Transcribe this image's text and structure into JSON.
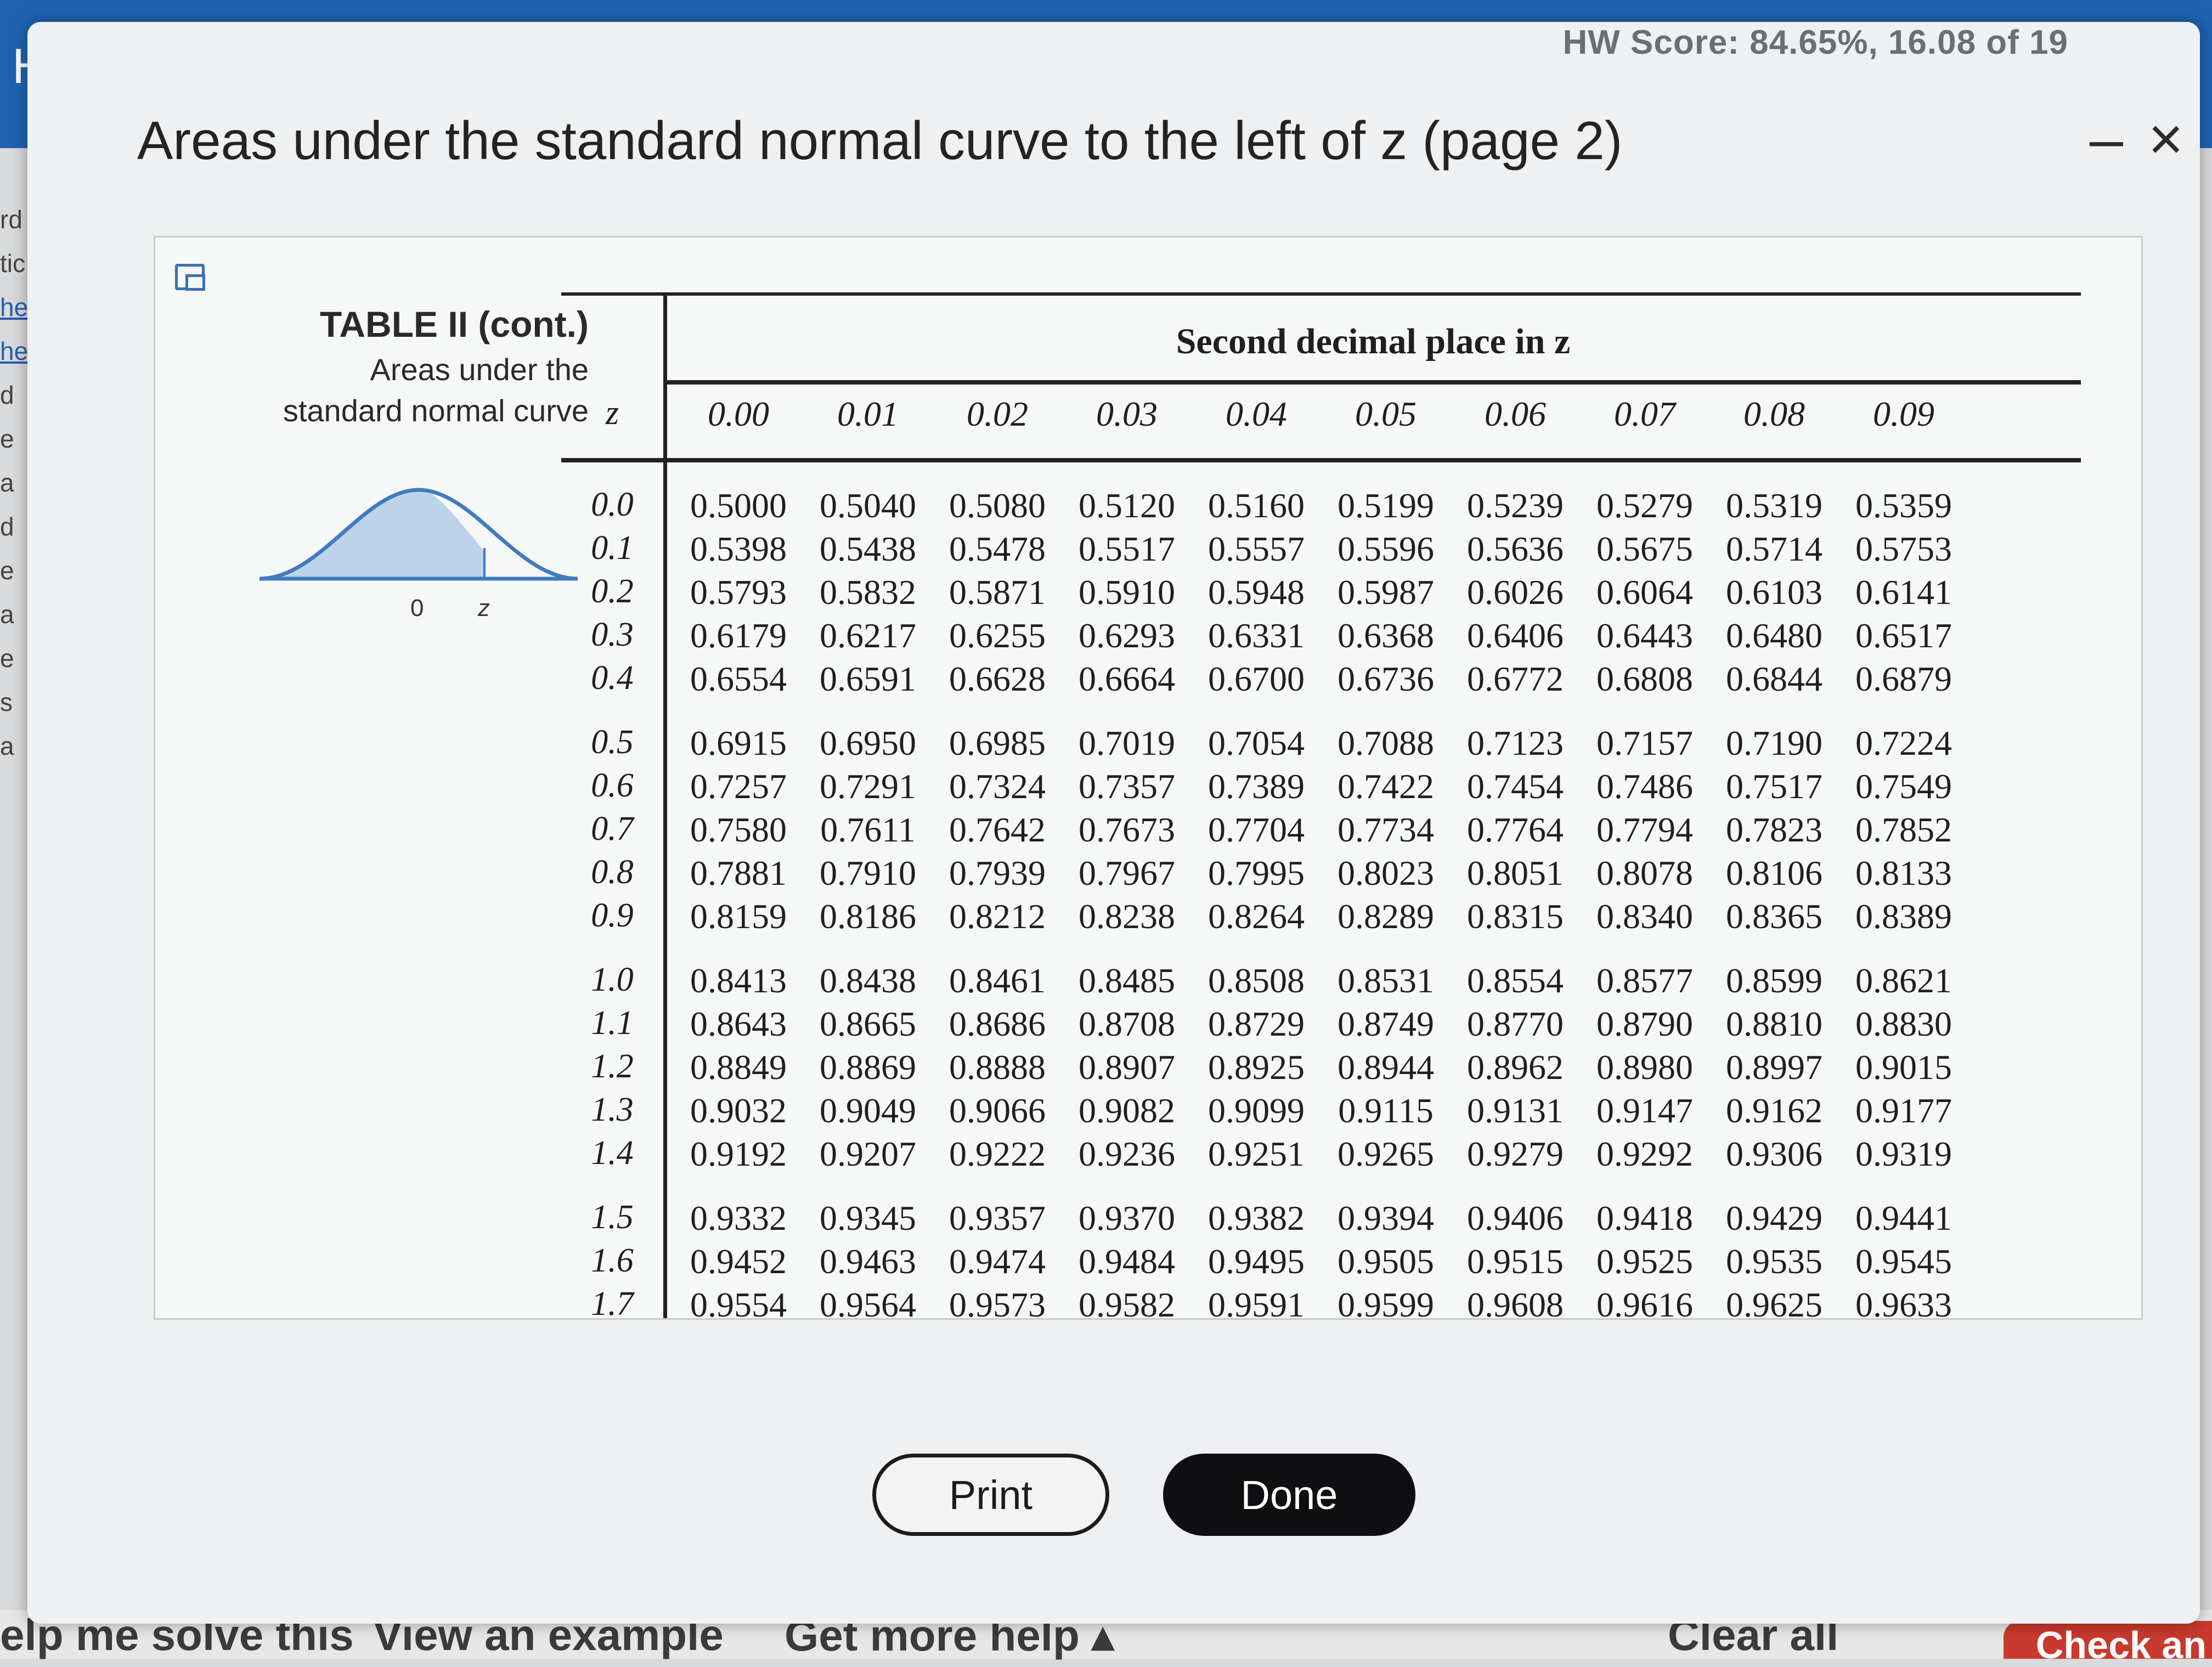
{
  "background": {
    "app_letter": "H",
    "side_fragments": [
      "rd",
      "tic",
      "he",
      "he",
      "d",
      "e",
      "a",
      "d",
      "e",
      "a",
      "e",
      "s",
      "a"
    ],
    "bottom_links": [
      "elp me solve this",
      "View an example",
      "Get more help ▴",
      "Clear all",
      "Check an"
    ]
  },
  "modal": {
    "hw_score": "HW Score: 84.65%, 16.08 of 19",
    "title": "Areas under the standard normal curve to the left of z (page 2)",
    "minimize_label": "–",
    "close_label": "×",
    "buttons": {
      "print": "Print",
      "done": "Done"
    }
  },
  "table": {
    "caption_title": "TABLE II   (cont.)",
    "caption_line1": "Areas under the",
    "caption_line2": "standard normal curve",
    "curve_labels": {
      "zero": "0",
      "z": "z"
    },
    "column_group_label": "Second decimal place in z",
    "z_header": "z",
    "columns": [
      "0.00",
      "0.01",
      "0.02",
      "0.03",
      "0.04",
      "0.05",
      "0.06",
      "0.07",
      "0.08",
      "0.09"
    ],
    "rows": [
      {
        "z": "0.0",
        "values": [
          "0.5000",
          "0.5040",
          "0.5080",
          "0.5120",
          "0.5160",
          "0.5199",
          "0.5239",
          "0.5279",
          "0.5319",
          "0.5359"
        ]
      },
      {
        "z": "0.1",
        "values": [
          "0.5398",
          "0.5438",
          "0.5478",
          "0.5517",
          "0.5557",
          "0.5596",
          "0.5636",
          "0.5675",
          "0.5714",
          "0.5753"
        ]
      },
      {
        "z": "0.2",
        "values": [
          "0.5793",
          "0.5832",
          "0.5871",
          "0.5910",
          "0.5948",
          "0.5987",
          "0.6026",
          "0.6064",
          "0.6103",
          "0.6141"
        ]
      },
      {
        "z": "0.3",
        "values": [
          "0.6179",
          "0.6217",
          "0.6255",
          "0.6293",
          "0.6331",
          "0.6368",
          "0.6406",
          "0.6443",
          "0.6480",
          "0.6517"
        ]
      },
      {
        "z": "0.4",
        "values": [
          "0.6554",
          "0.6591",
          "0.6628",
          "0.6664",
          "0.6700",
          "0.6736",
          "0.6772",
          "0.6808",
          "0.6844",
          "0.6879"
        ]
      },
      {
        "z": "0.5",
        "values": [
          "0.6915",
          "0.6950",
          "0.6985",
          "0.7019",
          "0.7054",
          "0.7088",
          "0.7123",
          "0.7157",
          "0.7190",
          "0.7224"
        ]
      },
      {
        "z": "0.6",
        "values": [
          "0.7257",
          "0.7291",
          "0.7324",
          "0.7357",
          "0.7389",
          "0.7422",
          "0.7454",
          "0.7486",
          "0.7517",
          "0.7549"
        ]
      },
      {
        "z": "0.7",
        "values": [
          "0.7580",
          "0.7611",
          "0.7642",
          "0.7673",
          "0.7704",
          "0.7734",
          "0.7764",
          "0.7794",
          "0.7823",
          "0.7852"
        ]
      },
      {
        "z": "0.8",
        "values": [
          "0.7881",
          "0.7910",
          "0.7939",
          "0.7967",
          "0.7995",
          "0.8023",
          "0.8051",
          "0.8078",
          "0.8106",
          "0.8133"
        ]
      },
      {
        "z": "0.9",
        "values": [
          "0.8159",
          "0.8186",
          "0.8212",
          "0.8238",
          "0.8264",
          "0.8289",
          "0.8315",
          "0.8340",
          "0.8365",
          "0.8389"
        ]
      },
      {
        "z": "1.0",
        "values": [
          "0.8413",
          "0.8438",
          "0.8461",
          "0.8485",
          "0.8508",
          "0.8531",
          "0.8554",
          "0.8577",
          "0.8599",
          "0.8621"
        ]
      },
      {
        "z": "1.1",
        "values": [
          "0.8643",
          "0.8665",
          "0.8686",
          "0.8708",
          "0.8729",
          "0.8749",
          "0.8770",
          "0.8790",
          "0.8810",
          "0.8830"
        ]
      },
      {
        "z": "1.2",
        "values": [
          "0.8849",
          "0.8869",
          "0.8888",
          "0.8907",
          "0.8925",
          "0.8944",
          "0.8962",
          "0.8980",
          "0.8997",
          "0.9015"
        ]
      },
      {
        "z": "1.3",
        "values": [
          "0.9032",
          "0.9049",
          "0.9066",
          "0.9082",
          "0.9099",
          "0.9115",
          "0.9131",
          "0.9147",
          "0.9162",
          "0.9177"
        ]
      },
      {
        "z": "1.4",
        "values": [
          "0.9192",
          "0.9207",
          "0.9222",
          "0.9236",
          "0.9251",
          "0.9265",
          "0.9279",
          "0.9292",
          "0.9306",
          "0.9319"
        ]
      },
      {
        "z": "1.5",
        "values": [
          "0.9332",
          "0.9345",
          "0.9357",
          "0.9370",
          "0.9382",
          "0.9394",
          "0.9406",
          "0.9418",
          "0.9429",
          "0.9441"
        ]
      },
      {
        "z": "1.6",
        "values": [
          "0.9452",
          "0.9463",
          "0.9474",
          "0.9484",
          "0.9495",
          "0.9505",
          "0.9515",
          "0.9525",
          "0.9535",
          "0.9545"
        ]
      },
      {
        "z": "1.7",
        "values": [
          "0.9554",
          "0.9564",
          "0.9573",
          "0.9582",
          "0.9591",
          "0.9599",
          "0.9608",
          "0.9616",
          "0.9625",
          "0.9633"
        ]
      }
    ]
  }
}
